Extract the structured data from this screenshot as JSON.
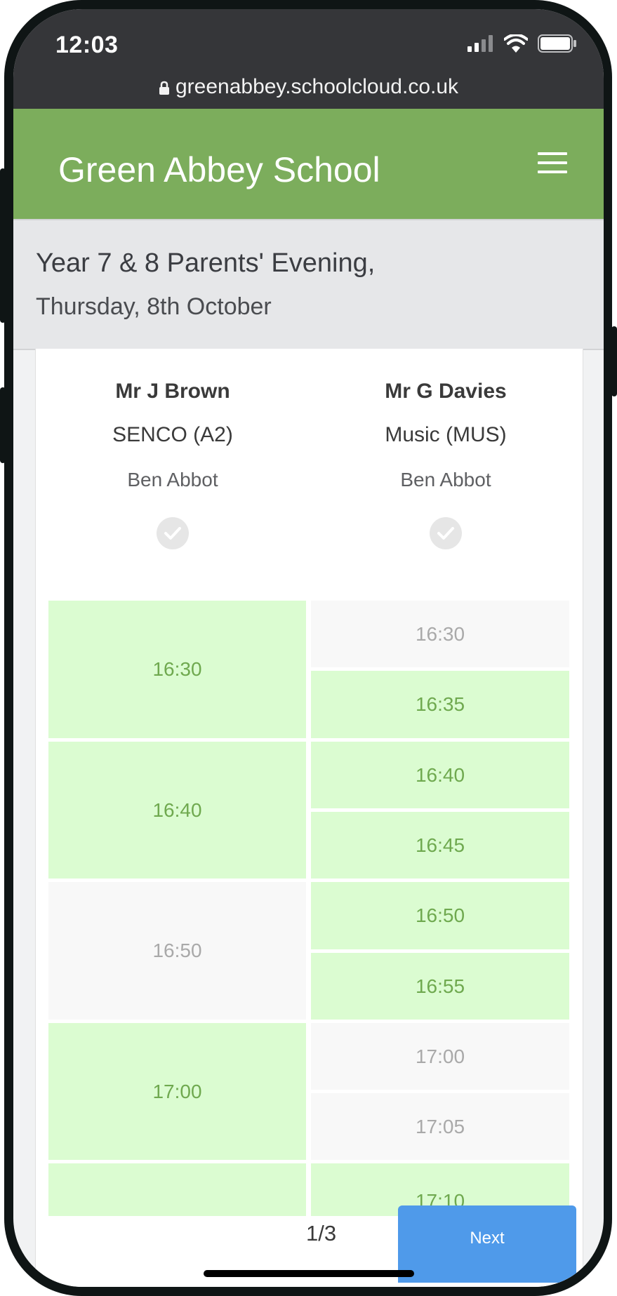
{
  "status_bar": {
    "time": "12:03",
    "url": "greenabbey.schoolcloud.co.uk"
  },
  "header": {
    "school_name": "Green Abbey School"
  },
  "event": {
    "title": "Year 7 & 8 Parents' Evening,",
    "date": "Thursday, 8th October"
  },
  "teachers": [
    {
      "name": "Mr J Brown",
      "subject": "SENCO (A2)",
      "student": "Ben Abbot"
    },
    {
      "name": "Mr G Davies",
      "subject": "Music (MUS)",
      "student": "Ben Abbot"
    }
  ],
  "slots": {
    "brown": [
      {
        "time": "16:30",
        "available": true
      },
      {
        "time": "16:40",
        "available": true
      },
      {
        "time": "16:50",
        "available": false
      },
      {
        "time": "17:00",
        "available": true
      },
      {
        "time": "",
        "available": true
      }
    ],
    "davies": [
      {
        "time": "16:30",
        "available": false
      },
      {
        "time": "16:35",
        "available": true
      },
      {
        "time": "16:40",
        "available": true
      },
      {
        "time": "16:45",
        "available": true
      },
      {
        "time": "16:50",
        "available": true
      },
      {
        "time": "16:55",
        "available": true
      },
      {
        "time": "17:00",
        "available": false
      },
      {
        "time": "17:05",
        "available": false
      },
      {
        "time": "17:10",
        "available": true
      }
    ]
  },
  "pagination": {
    "page": "1/3",
    "next_label": "Next"
  },
  "colors": {
    "header_green": "#7cad5c",
    "slot_available": "#dbfcd1",
    "slot_text_available": "#6fa94f",
    "next_blue": "#4f9aea"
  }
}
